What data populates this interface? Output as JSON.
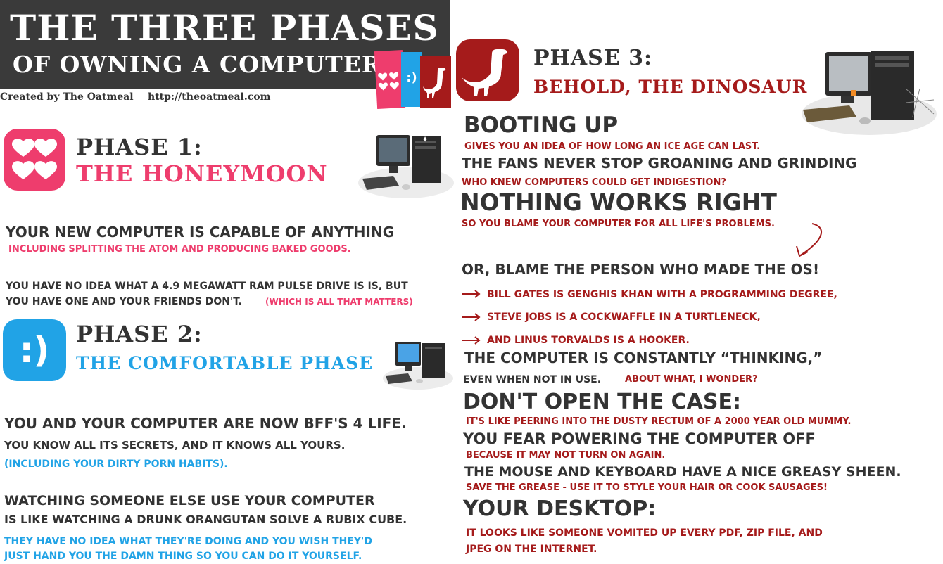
{
  "header": {
    "title_line1": "THE THREE PHASES",
    "title_line2": "OF OWNING A COMPUTER",
    "credit_author": "Created by The Oatmeal",
    "credit_url": "http://theoatmeal.com",
    "mini_icons": [
      "hearts-icon",
      "smiley-icon",
      "dinosaur-icon"
    ]
  },
  "colors": {
    "pink": "#ee3d6d",
    "blue": "#21a3e6",
    "red": "#a51b1b",
    "dark": "#333333",
    "banner": "#3a3a3a"
  },
  "phase1": {
    "number": "PHASE 1:",
    "name": "THE HONEYMOON",
    "icon": "hearts-icon",
    "line1": "YOUR NEW COMPUTER IS CAPABLE OF ANYTHING",
    "line1_sub": "INCLUDING SPLITTING THE ATOM AND PRODUCING BAKED GOODS.",
    "line2a": "YOU HAVE NO IDEA WHAT A 4.9 MEGAWATT RAM  PULSE DRIVE IS IS, BUT",
    "line2b": "YOU HAVE ONE AND YOUR FRIENDS DON'T.",
    "line2_aside": "(WHICH IS ALL THAT MATTERS)"
  },
  "phase2": {
    "number": "PHASE 2:",
    "name": "THE COMFORTABLE PHASE",
    "icon_text": ":)",
    "line1": "YOU AND YOUR COMPUTER ARE NOW BFF'S 4 LIFE.",
    "line2": "YOU KNOW ALL ITS SECRETS, AND IT KNOWS ALL YOURS.",
    "line3": "(INCLUDING YOUR DIRTY PORN HABITS).",
    "line4": "WATCHING SOMEONE ELSE USE YOUR COMPUTER",
    "line5": "IS LIKE WATCHING A DRUNK ORANGUTAN SOLVE A RUBIX CUBE.",
    "line6a": "THEY HAVE NO IDEA WHAT THEY'RE DOING AND YOU WISH THEY'D",
    "line6b": "JUST HAND YOU THE DAMN THING SO YOU CAN DO IT YOURSELF."
  },
  "phase3": {
    "number": "PHASE 3:",
    "name": "BEHOLD, THE DINOSAUR",
    "icon": "dinosaur-icon",
    "booting": "BOOTING UP",
    "booting_sub": "GIVES YOU AN IDEA OF HOW LONG AN ICE AGE CAN LAST.",
    "fans": "THE FANS NEVER STOP GROANING AND GRINDING",
    "fans_sub": "WHO KNEW COMPUTERS COULD GET INDIGESTION?",
    "nothing": "NOTHING WORKS RIGHT",
    "nothing_sub": "SO YOU BLAME YOUR COMPUTER FOR ALL LIFE'S PROBLEMS.",
    "blame": "OR, BLAME THE PERSON WHO MADE THE OS!",
    "bullets": [
      "BILL GATES IS GENGHIS KHAN WITH A PROGRAMMING DEGREE,",
      "STEVE JOBS IS A COCKWAFFLE IN A TURTLENECK,",
      "AND LINUS TORVALDS IS A HOOKER."
    ],
    "thinking": "THE COMPUTER IS CONSTANTLY “THINKING,”",
    "thinking_sub": "EVEN WHEN NOT IN USE.",
    "thinking_aside": "ABOUT WHAT, I WONDER?",
    "case": "DON'T OPEN THE CASE:",
    "case_sub": "IT'S LIKE PEERING INTO THE DUSTY RECTUM OF A 2000 YEAR OLD MUMMY.",
    "fear": "YOU FEAR POWERING THE COMPUTER OFF",
    "fear_sub": "BECAUSE IT MAY NOT TURN ON AGAIN.",
    "mouse": "THE MOUSE AND KEYBOARD HAVE A NICE GREASY SHEEN.",
    "mouse_sub": "SAVE THE GREASE - USE IT TO STYLE YOUR HAIR OR COOK SAUSAGES!",
    "desktop": "YOUR DESKTOP:",
    "desktop_sub1": "IT LOOKS LIKE SOMEONE VOMITED UP EVERY PDF,  ZIP FILE, AND",
    "desktop_sub2": "JPEG ON THE INTERNET."
  }
}
